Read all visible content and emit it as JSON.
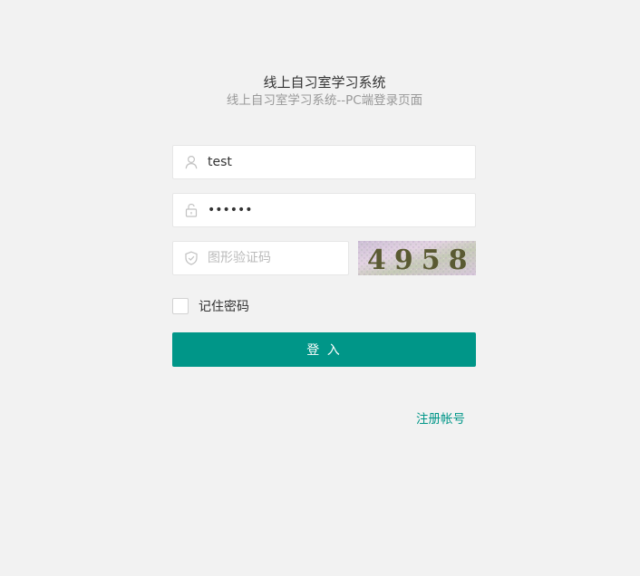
{
  "header": {
    "title": "线上自习室学习系统",
    "subtitle": "线上自习室学习系统--PC端登录页面"
  },
  "form": {
    "username": {
      "value": "test",
      "icon": "user-icon"
    },
    "password": {
      "value": "123456",
      "icon": "lock-icon"
    },
    "captcha": {
      "value": "",
      "placeholder": "图形验证码",
      "icon": "shield-icon",
      "image_text": "4958"
    },
    "remember": {
      "label": "记住密码",
      "checked": false
    },
    "login_label": "登 入",
    "register_label": "注册帐号"
  },
  "colors": {
    "accent": "#009688",
    "background": "#f2f2f2"
  }
}
